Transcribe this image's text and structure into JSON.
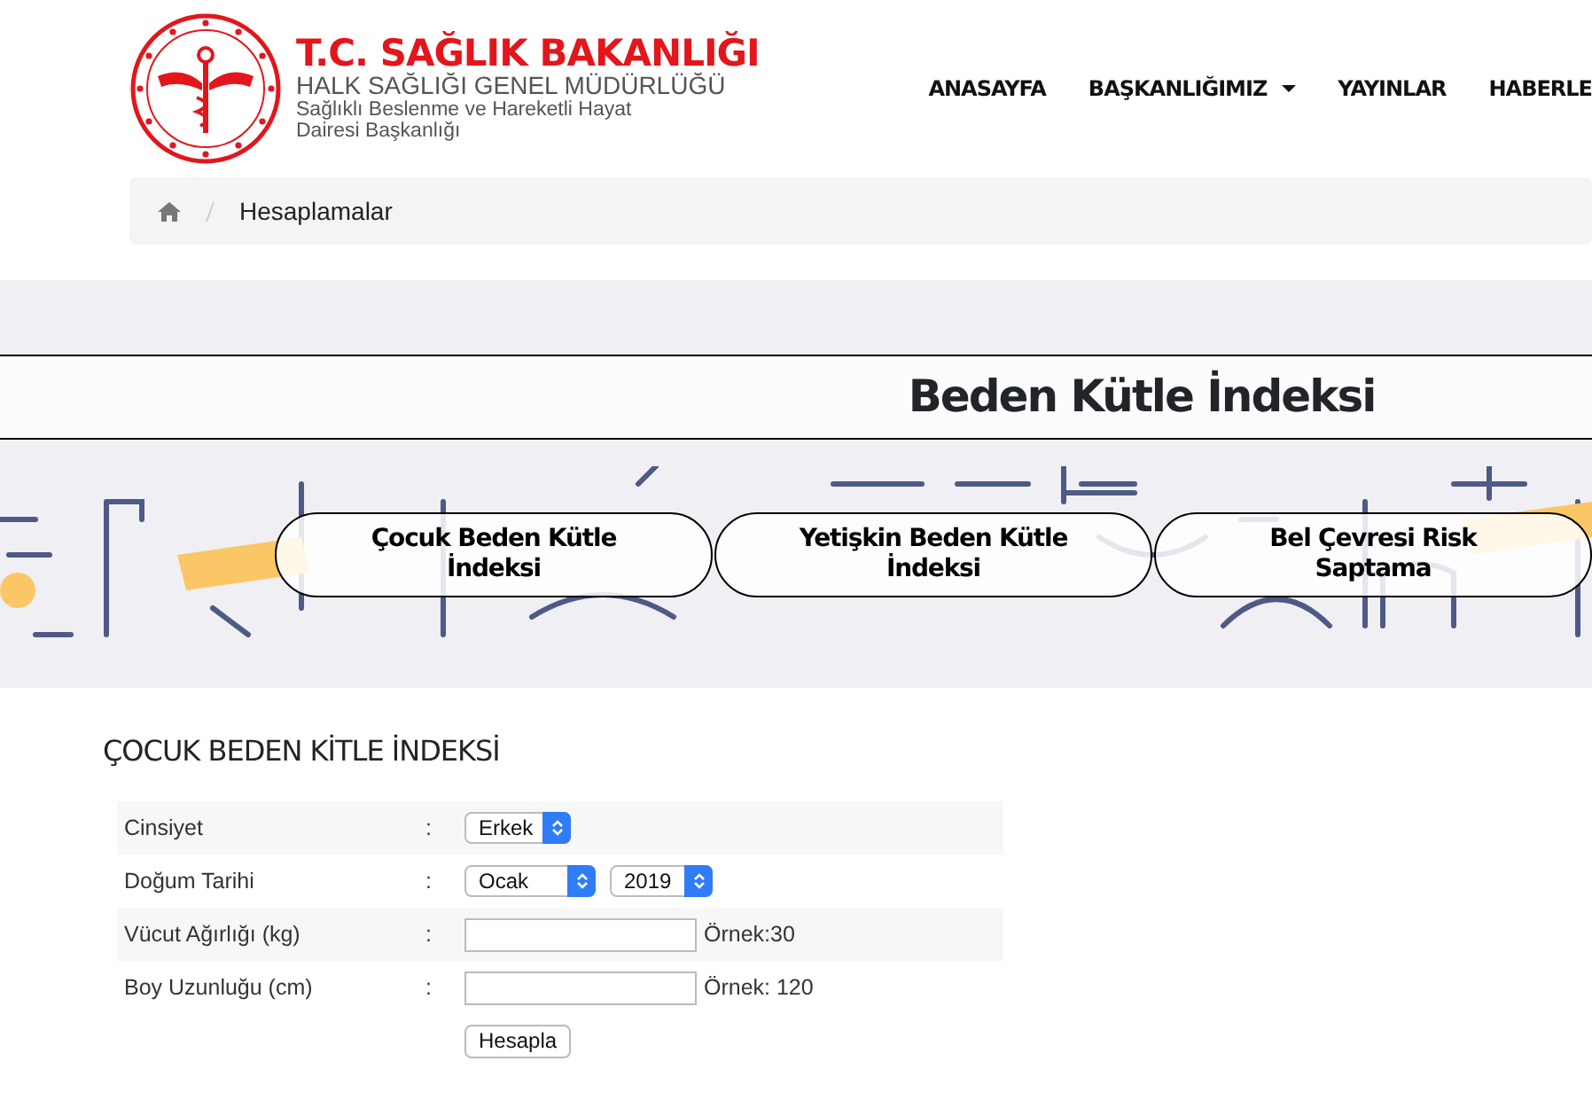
{
  "header": {
    "logo": {
      "title": "T.C. SAĞLIK BAKANLIĞI",
      "subtitle": "HALK SAĞLIĞI GENEL MÜDÜRLÜĞÜ",
      "line_1": "Sağlıklı Beslenme ve Hareketli Hayat",
      "line_2": "Dairesi Başkanlığı"
    },
    "nav": [
      {
        "label": "ANASAYFA",
        "dropdown": false
      },
      {
        "label": "BAŞKANLIĞIMIZ",
        "dropdown": true
      },
      {
        "label": "YAYINLAR",
        "dropdown": false
      },
      {
        "label": "HABERLE",
        "dropdown": false
      }
    ]
  },
  "breadcrumb": [
    "Hesaplamalar"
  ],
  "banner": {
    "title": "Beden Kütle İndeksi",
    "buttons": [
      {
        "label": "Çocuk Beden Kütle İndeksi"
      },
      {
        "label": "Yetişkin Beden Kütle İndeksi"
      },
      {
        "label": "Bel Çevresi Risk Saptama"
      }
    ]
  },
  "form": {
    "title": "ÇOCUK BEDEN KİTLE İNDEKSİ",
    "rows": [
      {
        "label": "Cinsiyet",
        "separator": ":",
        "kind": "select",
        "selects": [
          "Erkek"
        ]
      },
      {
        "label": "Doğum Tarihi",
        "separator": ":",
        "kind": "select",
        "selects": [
          "Ocak",
          "2019"
        ]
      },
      {
        "label": "Vücut Ağırlığı (kg)",
        "separator": ":",
        "kind": "input",
        "hint": "Örnek:30"
      },
      {
        "label": "Boy Uzunluğu (cm)",
        "separator": ":",
        "kind": "input",
        "hint": "Örnek: 120"
      }
    ],
    "submit": "Hesapla"
  }
}
